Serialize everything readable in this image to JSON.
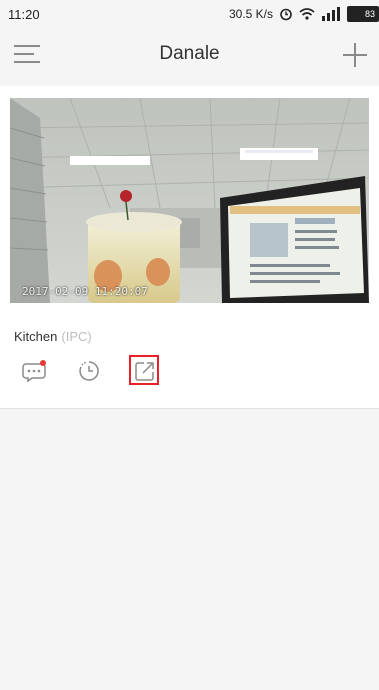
{
  "status_bar": {
    "time": "11:20",
    "net_speed": "30.5 K/s",
    "battery": "83",
    "icons": [
      "alarm-clock-icon",
      "wifi-icon",
      "signal-icon",
      "battery-icon"
    ]
  },
  "header": {
    "title": "Danale",
    "menu_icon": "hamburger-menu-icon",
    "add_icon": "plus-icon"
  },
  "device": {
    "timestamp": "2017-02-09 11:20:07",
    "name": "Kitchen",
    "type": "(IPC)",
    "actions": [
      {
        "name": "message",
        "icon": "message-icon",
        "has_badge": true
      },
      {
        "name": "history",
        "icon": "clock-history-icon",
        "has_badge": false
      },
      {
        "name": "share",
        "icon": "share-icon",
        "highlighted": true
      }
    ]
  },
  "colors": {
    "background": "#f5f5f5",
    "card": "#ffffff",
    "badge": "#e53935",
    "highlight": "#e8202a"
  }
}
